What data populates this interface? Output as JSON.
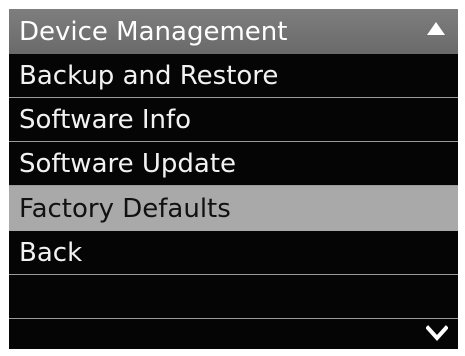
{
  "menu": {
    "title": "Device Management",
    "items": [
      {
        "label": "Backup and Restore",
        "selected": false
      },
      {
        "label": "Software Info",
        "selected": false
      },
      {
        "label": "Software Update",
        "selected": false
      },
      {
        "label": "Factory Defaults",
        "selected": true
      },
      {
        "label": "Back",
        "selected": false
      }
    ],
    "scroll_up_icon": "chevron-up-icon",
    "scroll_down_icon": "chevron-down-icon"
  },
  "colors": {
    "background": "#050505",
    "header": "#737373",
    "selected": "#a9a9a9",
    "text": "#f2f2f2"
  }
}
